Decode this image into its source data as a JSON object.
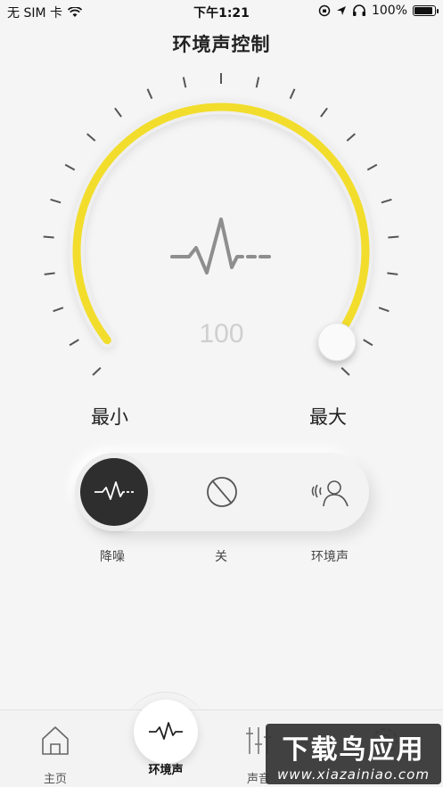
{
  "status_bar": {
    "carrier": "无 SIM 卡",
    "time": "下午1:21",
    "battery": "100%"
  },
  "header": {
    "title": "环境声控制"
  },
  "dial": {
    "value": "100",
    "level_fraction": 1.0,
    "min_label": "最小",
    "max_label": "最大",
    "accent_color": "#f2dd2c"
  },
  "modes": [
    {
      "label": "降噪",
      "icon": "waveform-icon",
      "active": true
    },
    {
      "label": "关",
      "icon": "off-icon",
      "active": false
    },
    {
      "label": "环境声",
      "icon": "ambient-person-icon",
      "active": false
    }
  ],
  "bottom_nav": [
    {
      "label": "主页",
      "icon": "home-icon",
      "active": false
    },
    {
      "label": "环境声",
      "icon": "waveform-icon",
      "active": true
    },
    {
      "label": "声音",
      "icon": "equalizer-icon",
      "active": false
    },
    {
      "label": "",
      "icon": "settings-icon",
      "active": false
    }
  ],
  "watermark": {
    "title": "下载鸟应用",
    "subtitle": "www.xiazainiao.com"
  }
}
